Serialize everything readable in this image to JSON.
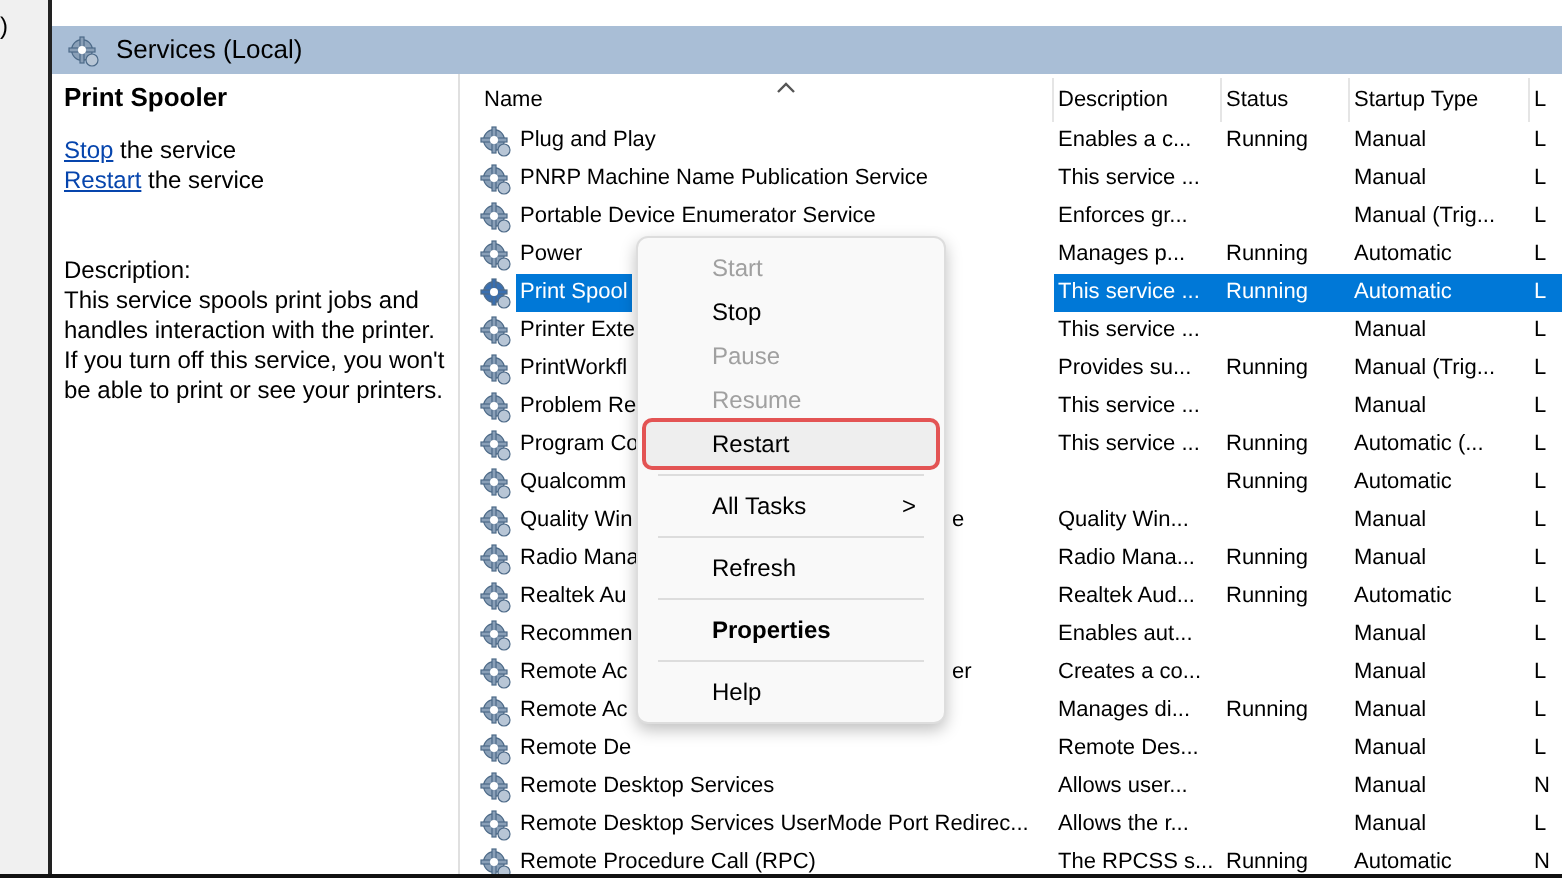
{
  "outer_fragment": ")",
  "header": {
    "title": "Services (Local)"
  },
  "details": {
    "title": "Print Spooler",
    "actions": [
      {
        "link": "Stop",
        "rest": " the service"
      },
      {
        "link": "Restart",
        "rest": " the service"
      }
    ],
    "description_label": "Description:",
    "description": "This service spools print jobs and handles interaction with the printer. If you turn off this service, you won't be able to print or see your printers."
  },
  "table": {
    "columns": [
      "Name",
      "Description",
      "Status",
      "Startup Type",
      "L"
    ],
    "rows": [
      {
        "name": "Plug and Play",
        "description": "Enables a c...",
        "status": "Running",
        "startup": "Manual",
        "column_5": "L",
        "selected": false
      },
      {
        "name": "PNRP Machine Name Publication Service",
        "description": "This service ...",
        "status": "",
        "startup": "Manual",
        "column_5": "L",
        "selected": false
      },
      {
        "name": "Portable Device Enumerator Service",
        "description": "Enforces gr...",
        "status": "",
        "startup": "Manual (Trig...",
        "column_5": "L",
        "selected": false
      },
      {
        "name": "Power",
        "description": "Manages p...",
        "status": "Running",
        "startup": "Automatic",
        "column_5": "L",
        "selected": false
      },
      {
        "name": "Print Spool",
        "description": "This service ...",
        "status": "Running",
        "startup": "Automatic",
        "column_5": "L",
        "selected": true
      },
      {
        "name": "Printer Exte",
        "description": "This service ...",
        "status": "",
        "startup": "Manual",
        "column_5": "L",
        "selected": false
      },
      {
        "name": "PrintWorkfl",
        "description": "Provides su...",
        "status": "Running",
        "startup": "Manual (Trig...",
        "column_5": "L",
        "selected": false
      },
      {
        "name": "Problem Re",
        "description": "This service ...",
        "status": "",
        "startup": "Manual",
        "column_5": "L",
        "selected": false
      },
      {
        "name": "Program Co",
        "description": "This service ...",
        "status": "Running",
        "startup": "Automatic (...",
        "column_5": "L",
        "selected": false
      },
      {
        "name": "Qualcomm",
        "description": "",
        "status": "Running",
        "startup": "Automatic",
        "column_5": "L",
        "selected": false
      },
      {
        "name": "Quality Win",
        "name_tail": "e",
        "description": "Quality Win...",
        "status": "",
        "startup": "Manual",
        "column_5": "L",
        "selected": false
      },
      {
        "name": "Radio Mana",
        "description": "Radio Mana...",
        "status": "Running",
        "startup": "Manual",
        "column_5": "L",
        "selected": false
      },
      {
        "name": "Realtek Au",
        "description": "Realtek Aud...",
        "status": "Running",
        "startup": "Automatic",
        "column_5": "L",
        "selected": false
      },
      {
        "name": "Recommen",
        "description": "Enables aut...",
        "status": "",
        "startup": "Manual",
        "column_5": "L",
        "selected": false
      },
      {
        "name": "Remote Ac",
        "name_tail": "er",
        "description": "Creates a co...",
        "status": "",
        "startup": "Manual",
        "column_5": "L",
        "selected": false
      },
      {
        "name": "Remote Ac",
        "description": "Manages di...",
        "status": "Running",
        "startup": "Manual",
        "column_5": "L",
        "selected": false
      },
      {
        "name": "Remote De",
        "description": "Remote Des...",
        "status": "",
        "startup": "Manual",
        "column_5": "L",
        "selected": false
      },
      {
        "name": "Remote Desktop Services",
        "description": "Allows user...",
        "status": "",
        "startup": "Manual",
        "column_5": "N",
        "selected": false
      },
      {
        "name": "Remote Desktop Services UserMode Port Redirec...",
        "description": "Allows the r...",
        "status": "",
        "startup": "Manual",
        "column_5": "L",
        "selected": false
      },
      {
        "name": "Remote Procedure Call (RPC)",
        "description": "The RPCSS s...",
        "status": "Running",
        "startup": "Automatic",
        "column_5": "N",
        "selected": false
      }
    ]
  },
  "context_menu": {
    "items": [
      {
        "kind": "item",
        "label": "Start",
        "disabled": true,
        "highlighted": false
      },
      {
        "kind": "item",
        "label": "Stop",
        "disabled": false,
        "highlighted": false
      },
      {
        "kind": "item",
        "label": "Pause",
        "disabled": true,
        "highlighted": false
      },
      {
        "kind": "item",
        "label": "Resume",
        "disabled": true,
        "highlighted": false
      },
      {
        "kind": "item",
        "label": "Restart",
        "disabled": false,
        "highlighted": true
      },
      {
        "kind": "separator"
      },
      {
        "kind": "submenu",
        "label": "All Tasks",
        "arrow": ">",
        "disabled": false,
        "highlighted": false
      },
      {
        "kind": "separator"
      },
      {
        "kind": "item",
        "label": "Refresh",
        "disabled": false,
        "highlighted": false
      },
      {
        "kind": "separator"
      },
      {
        "kind": "default",
        "label": "Properties",
        "disabled": false,
        "highlighted": false
      },
      {
        "kind": "separator"
      },
      {
        "kind": "item",
        "label": "Help",
        "disabled": false,
        "highlighted": false
      }
    ]
  }
}
